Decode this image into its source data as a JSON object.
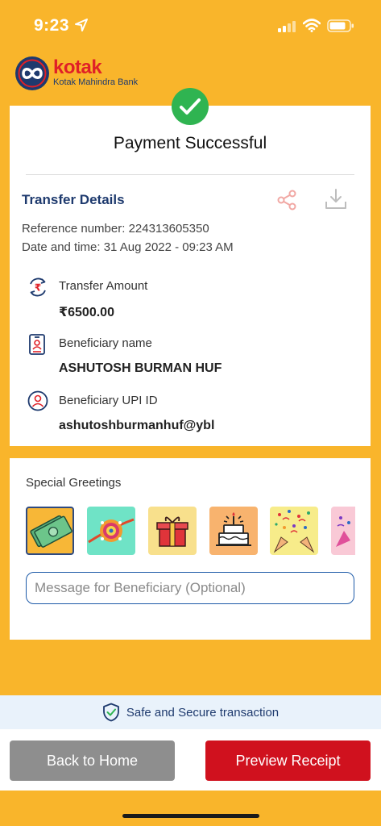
{
  "status_bar": {
    "time": "9:23"
  },
  "brand": {
    "name": "kotak",
    "subtitle": "Kotak Mahindra Bank"
  },
  "payment": {
    "title": "Payment Successful"
  },
  "transfer": {
    "section_title": "Transfer Details",
    "reference": "Reference number: 224313605350",
    "datetime": "Date and time: 31 Aug 2022 - 09:23 AM",
    "amount_label": "Transfer Amount",
    "amount_value": "₹6500.00",
    "beneficiary_label": "Beneficiary name",
    "beneficiary_value": "ASHUTOSH BURMAN HUF",
    "upi_label": "Beneficiary UPI ID",
    "upi_value": "ashutoshburmanhuf@ybl"
  },
  "greetings": {
    "title": "Special Greetings",
    "tiles": [
      "money-icon",
      "rakhi-icon",
      "gift-icon",
      "cake-icon",
      "celebration-icon",
      "party-icon"
    ],
    "message_placeholder": "Message for Beneficiary (Optional)"
  },
  "secure": {
    "text": "Safe and Secure transaction"
  },
  "actions": {
    "back_label": "Back to Home",
    "preview_label": "Preview Receipt"
  },
  "colors": {
    "background": "#F9B52B",
    "brand_red": "#E02027",
    "brand_navy": "#1E3A6E",
    "success_green": "#2FB451",
    "preview_button": "#D0111E",
    "back_button": "#8E8E8E"
  }
}
